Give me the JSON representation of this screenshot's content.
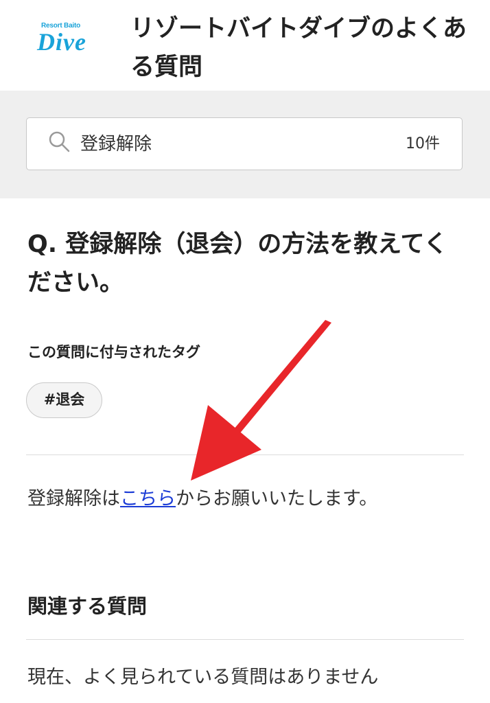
{
  "header": {
    "logo_small": "Resort Baito",
    "logo_big": "Dive",
    "title": "リゾートバイトダイブのよくある質問"
  },
  "search": {
    "value": "登録解除",
    "count": "10件"
  },
  "question": {
    "title": "Q. 登録解除（退会）の方法を教えてください。",
    "tags_label": "この質問に付与されたタグ",
    "tags": [
      "#退会"
    ]
  },
  "answer": {
    "before": "登録解除は",
    "link": "こちら",
    "after": "からお願いいたします。"
  },
  "related": {
    "title": "関連する質問",
    "empty_text": "現在、よく見られている質問はありません"
  },
  "colors": {
    "brand": "#1aa3d9",
    "link": "#1a3bd6",
    "annotation_arrow": "#e8262a"
  }
}
